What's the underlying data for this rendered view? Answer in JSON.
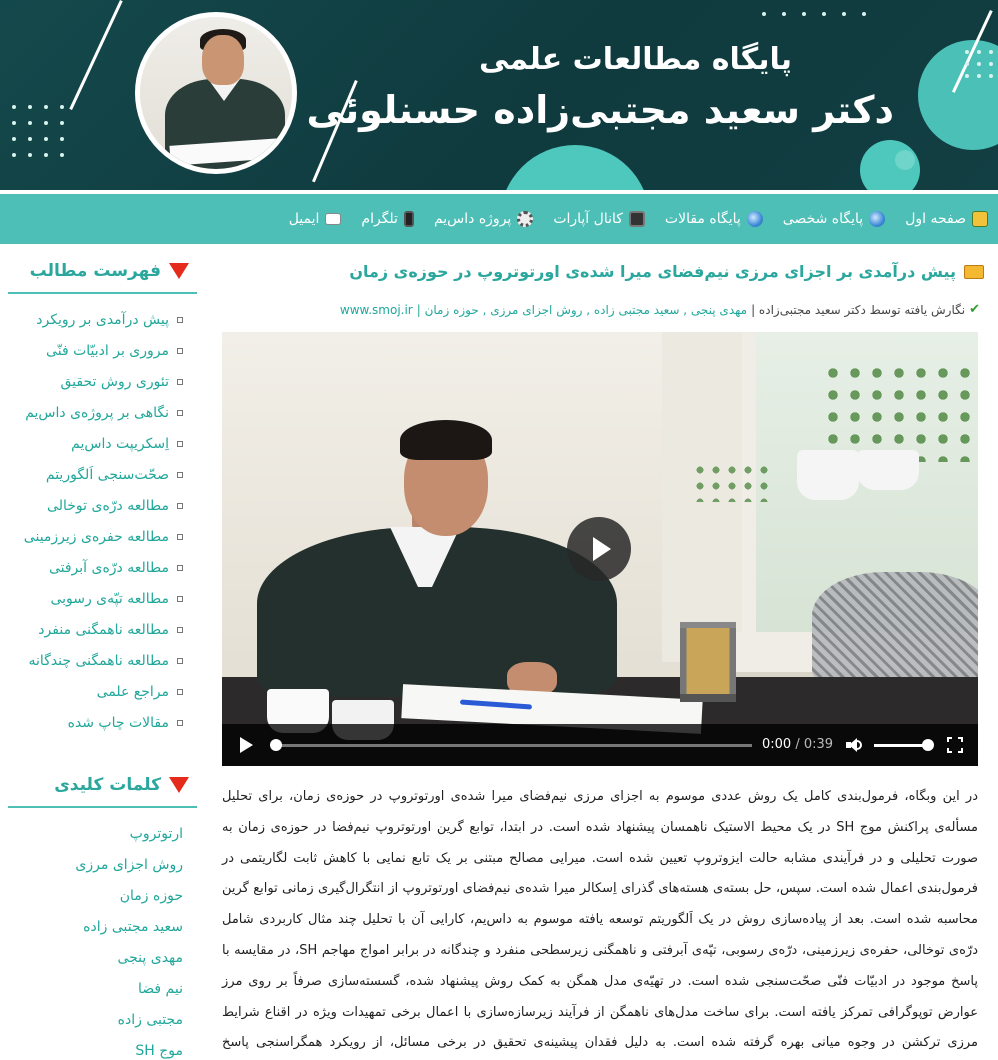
{
  "header": {
    "title_line1": "پایگاه مطالعات علمی",
    "title_line2": "دکتر سعید مجتبی‌زاده حسنلوئی"
  },
  "nav": {
    "items": [
      {
        "label": "صفحه اول",
        "icon": "home-icon"
      },
      {
        "label": "پایگاه شخصی",
        "icon": "globe-icon"
      },
      {
        "label": "پایگاه مقالات",
        "icon": "globe-icon"
      },
      {
        "label": "کانال آپارات",
        "icon": "film-icon"
      },
      {
        "label": "پروژه داس‌یم",
        "icon": "gear-icon"
      },
      {
        "label": "تلگرام",
        "icon": "phone-icon"
      },
      {
        "label": "ایمیل",
        "icon": "mail-icon"
      }
    ]
  },
  "sidebar": {
    "toc_title": "فهرست مطالب",
    "toc": [
      "پیش درآمدی بر رویکرد",
      "مروری بر ادبیّات فنّی",
      "تئوری روش تحقیق",
      "نگاهی بر پروژه‌ی داس‌یم",
      "اِسکریپت داس‌یم",
      "صحّت‌سنجی اَلگوریتم",
      "مطالعه درّه‌ی توخالی",
      "مطالعه حفره‌ی زیرزمینی",
      "مطالعه درّه‌ی آبرفتی",
      "مطالعه تپّه‌ی رسوبی",
      "مطالعه ناهمگنی منفرد",
      "مطالعه ناهمگنی چندگانه",
      "مراجع علمی",
      "مقالات چاپ شده"
    ],
    "keywords_title": "کلمات کلیدی",
    "keywords": [
      "ارتوتروپ",
      "روش اجزای مرزی",
      "حوزه زمان",
      "سعید مجتبی زاده",
      "مهدی پنجی",
      "نیم فضا",
      "مجتبی زاده",
      "موج SH"
    ]
  },
  "post": {
    "title": "پیش درآمدی بر اجزای مرزی نیم‌فضای میرا شده‌ی اورتوتروپ در حوزه‌ی زمان",
    "meta_prefix": "نگارش یافته توسط دکتر سعید مجتبی‌زاده |",
    "meta_tags": "مهدی پنجی , سعید مجتبی زاده , روش اجزای مرزی , حوزه زمان |",
    "meta_site": "www.smoj.ir",
    "body": "در این وبگاه، فرمول‌بندی کامل یک روش عددی موسوم به اجزای مرزی نیم‌فضای میرا شده‌ی اورتوتروپ در حوزه‌ی زمان، برای تحلیل مسأله‌ی پراکنش موج SH در یک محیط الاستیک ناهمسان پیشنهاد شده است. در ابتدا، توابع گرین اورتوتروپ نیم‌فضا در حوزه‌ی زمان به صورت تحلیلی و در فرآیندی مشابه حالت ایزوتروپ تعیین شده است. میرایی مصالح مبتنی بر یک تابع نمایی با کاهش ثابت لگاریتمی در فرمول‌بندی اعمال شده است. سپس، حل بسته‌ی هسته‌های گذرای اِسکالر میرا شده‌ی نیم‌فضای اورتوتروپ از انتگرال‌گیری زمانی توابع گرین محاسبه شده است. بعد از پیاده‌سازی روش در یک اَلگوریتم توسعه یافته موسوم به داس‌یم، کارایی آن با تحلیل چند مثال کاربردی شامل درّه‌ی توخالی، حفره‌ی زیرزمینی، درّه‌ی رسوبی، تپّه‌ی آبرفتی و ناهمگنی زیرسطحی منفرد و چندگانه در برابر امواج مهاجم SH، در مقایسه با پاسخ موجود در ادبیّات فنّی صحّت‌سنجی شده است. در تهیّه‌ی مدل همگن به کمک روش پیشنهاد شده، گسسته‌سازی صرفاً بر روی مرز عوارض توپوگرافی تمرکز یافته است. برای ساخت مدل‌های ناهمگن از فرآیند زیرسازه‌سازی با اعمال برخی تمهیدات ویژه در اقناع شرایط مرزی ترکشن در وجوه میانی بهره گرفته شده است. به دلیل فقدان پیشینه‌ی تحقیق در برخی مسائل، از رویکرد همگراسنجی پاسخ اورتوتروپ به حالت"
  },
  "video": {
    "current_time": "0:00",
    "duration": "0:39",
    "progress": 0,
    "volume": 0.85
  },
  "colors": {
    "banner": "#14494c",
    "accent": "#4dbfb6",
    "link": "#21a79b",
    "heading_marker": "#e52b1b"
  }
}
